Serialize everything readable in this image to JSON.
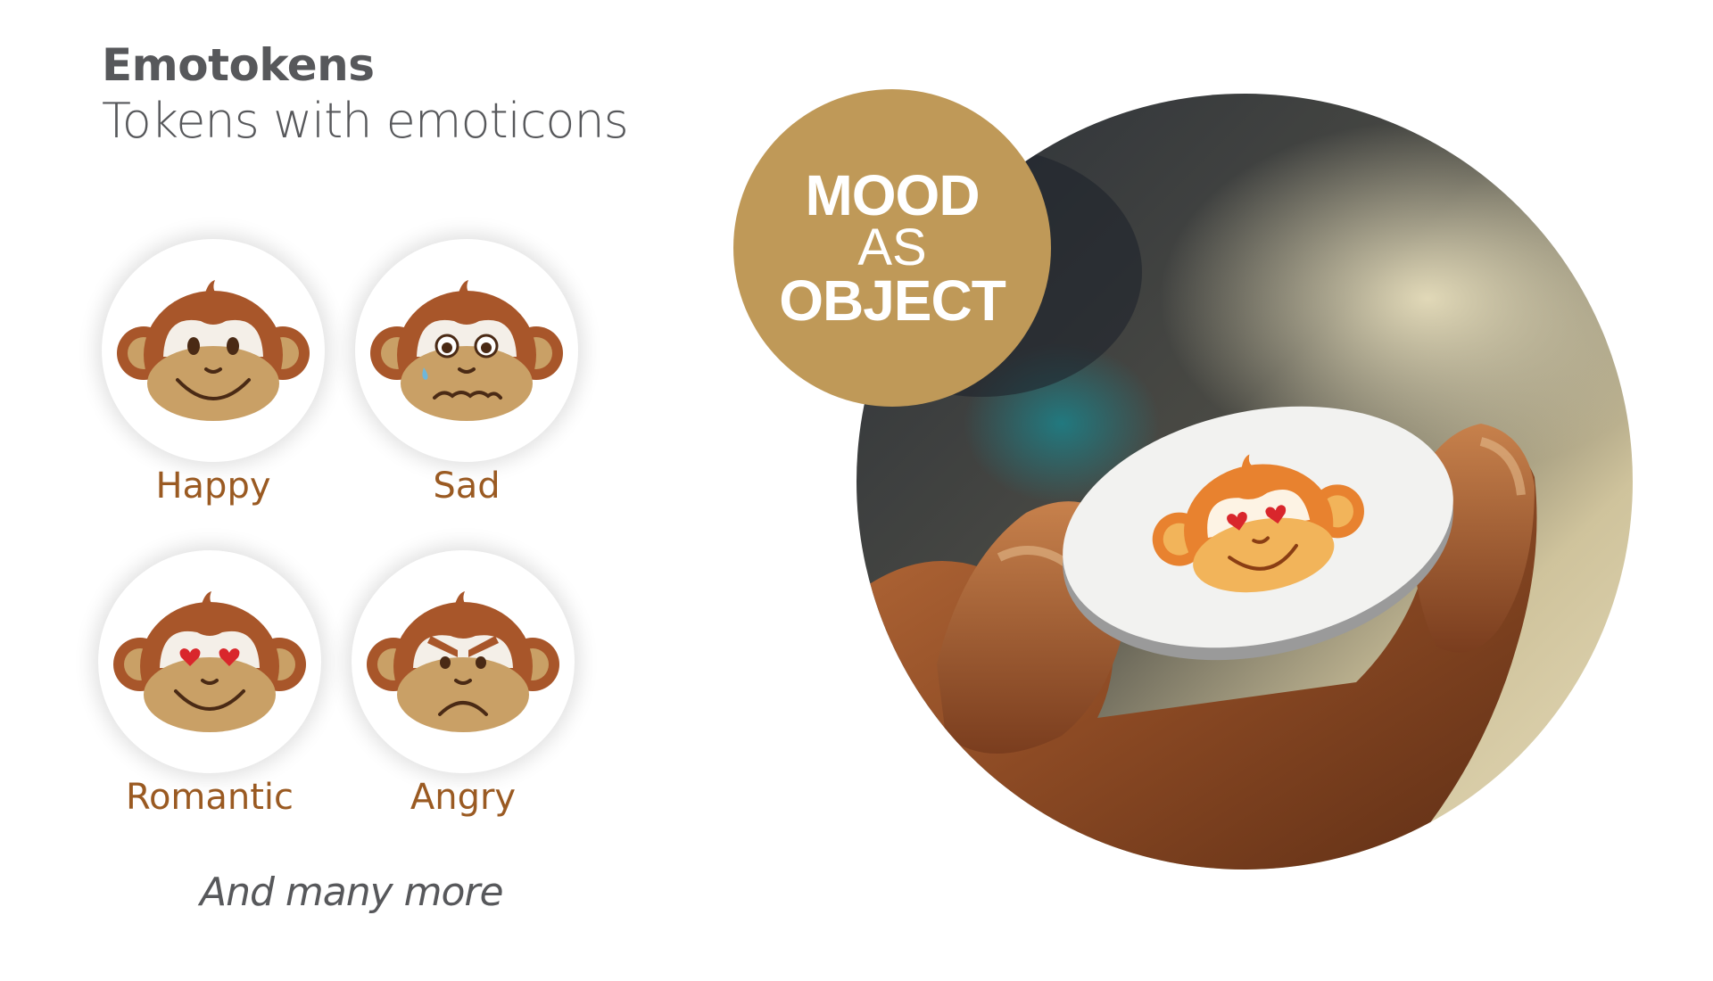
{
  "header": {
    "title": "Emotokens",
    "subtitle": "Tokens with emoticons"
  },
  "tokens": [
    {
      "label": "Happy",
      "icon": "happy-monkey-icon"
    },
    {
      "label": "Sad",
      "icon": "sad-monkey-icon"
    },
    {
      "label": "Romantic",
      "icon": "romantic-monkey-icon"
    },
    {
      "label": "Angry",
      "icon": "angry-monkey-icon"
    }
  ],
  "footer": {
    "more_text": "And many more"
  },
  "badge": {
    "line1": "MOOD",
    "line2": "AS",
    "line3": "OBJECT"
  },
  "colors": {
    "title_gray": "#57585b",
    "label_brown": "#9a5a22",
    "badge_gold": "#bf9958",
    "monkey_brown": "#a8562a",
    "monkey_face": "#c9a066",
    "token_monkey_orange": "#e8822f",
    "token_face_yellow": "#f2b45a"
  }
}
